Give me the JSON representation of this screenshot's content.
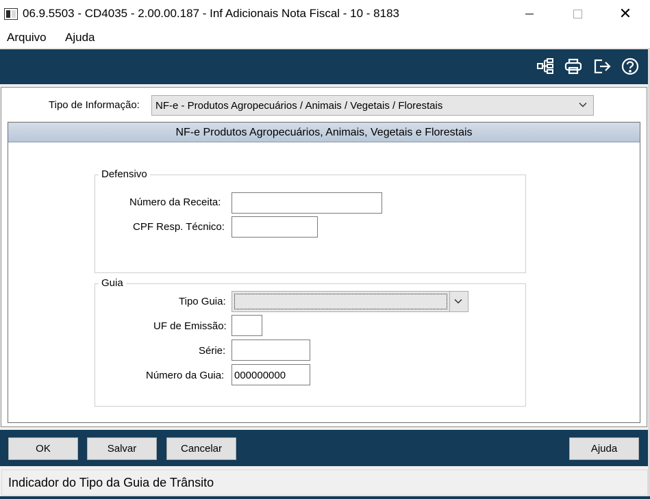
{
  "window": {
    "title": "06.9.5503 - CD4035 - 2.00.00.187 - Inf Adicionais Nota Fiscal - 10 - 8183",
    "close_glyph": "✕"
  },
  "menu": {
    "arquivo": "Arquivo",
    "ajuda": "Ajuda"
  },
  "toolbar": {
    "icons": [
      "tree-icon",
      "print-icon",
      "exit-icon",
      "help-icon"
    ],
    "color": "#143b57"
  },
  "form": {
    "tipo_informacao_label": "Tipo de Informação:",
    "tipo_informacao_value": "NF-e - Produtos Agropecuários / Animais / Vegetais / Florestais",
    "panel_title": "NF-e  Produtos Agropecuários, Animais, Vegetais e Florestais",
    "defensivo": {
      "legend": "Defensivo",
      "numero_receita_label": "Número da Receita:",
      "numero_receita_value": "",
      "cpf_label": "CPF Resp. Técnico:",
      "cpf_value": ""
    },
    "guia": {
      "legend": "Guia",
      "tipo_guia_label": "Tipo Guia:",
      "tipo_guia_value": "",
      "uf_label": "UF de Emissão:",
      "uf_value": "",
      "serie_label": "Série:",
      "serie_value": "",
      "numero_guia_label": "Número da Guia:",
      "numero_guia_value": "000000000"
    }
  },
  "buttons": {
    "ok": "OK",
    "salvar": "Salvar",
    "cancelar": "Cancelar",
    "ajuda": "Ajuda"
  },
  "status": {
    "text": "Indicador do Tipo da Guia de Trânsito"
  }
}
